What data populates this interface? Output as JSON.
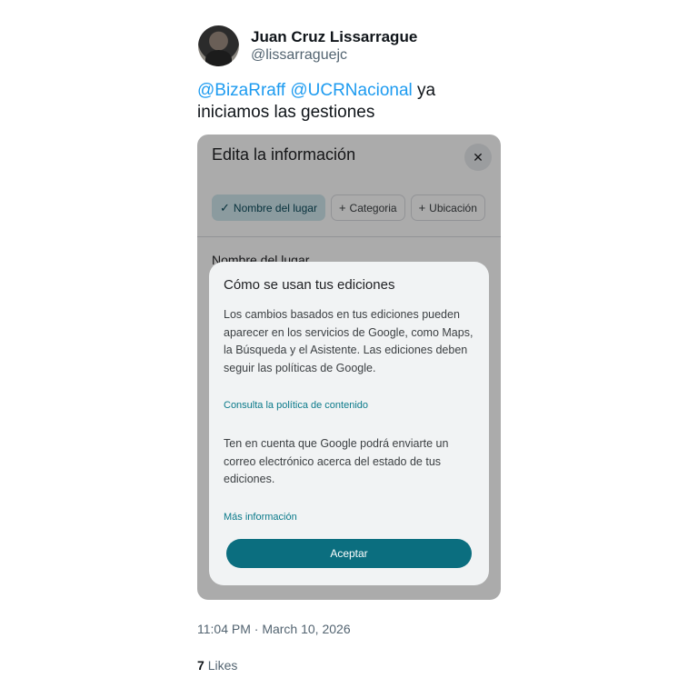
{
  "author": {
    "display_name": "Juan Cruz Lissarrague",
    "handle": "@lissarraguejc"
  },
  "tweet": {
    "mention1": "@BizaRraff",
    "mention2": "@UCRNacional",
    "text": "ya iniciamos las gestiones"
  },
  "screenshot": {
    "title": "Edita la información",
    "close_icon": "close-icon",
    "chips": [
      {
        "icon": "✓",
        "label": "Nombre del lugar"
      },
      {
        "icon": "+",
        "label": "Categoria"
      },
      {
        "icon": "+",
        "label": "Ubicación"
      }
    ],
    "field_label": "Nombre del lugar",
    "dialog": {
      "title": "Cómo se usan tus ediciones",
      "body1": "Los cambios basados en tus ediciones pueden aparecer en los servicios de Google, como Maps, la Búsqueda y el Asistente. Las ediciones deben seguir las políticas de Google.",
      "link1": "Consulta la política de contenido",
      "body2": "Ten en cuenta que Google podrá enviarte un correo electrónico acerca del estado de tus ediciones.",
      "link2": "Más información",
      "accept": "Aceptar"
    }
  },
  "meta": {
    "time": "11:04 PM · March 10, 2026",
    "likes_count": "7",
    "likes_label": "Likes"
  },
  "colors": {
    "mention": "#1d9bf0",
    "accent": "#0b6e7f"
  }
}
